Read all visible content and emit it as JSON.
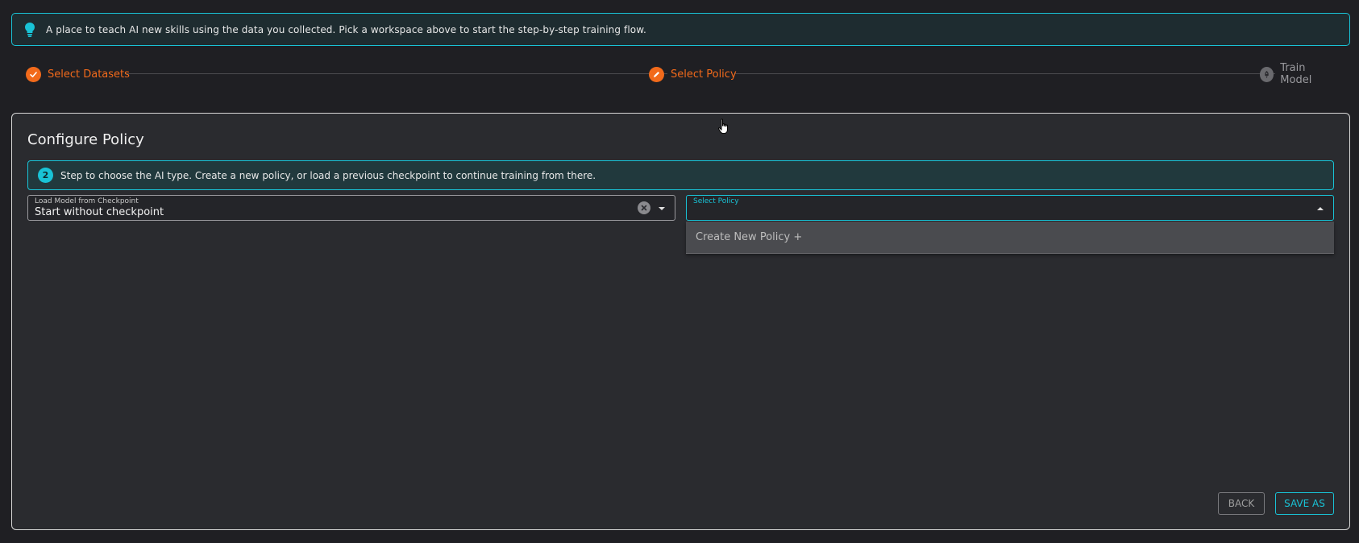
{
  "info_banner": {
    "icon": "lightbulb-icon",
    "text": "A place to teach AI new skills using the data you collected. Pick a workspace above to start the step-by-step training flow."
  },
  "stepper": {
    "steps": [
      {
        "label": "Select Datasets",
        "state": "done",
        "icon": "check-icon"
      },
      {
        "label": "Select Policy",
        "state": "active",
        "icon": "pencil-icon"
      },
      {
        "label": "Train Model",
        "state": "pending",
        "icon": "rocket-icon"
      }
    ]
  },
  "panel": {
    "title": "Configure Policy",
    "step_note": {
      "number": "2",
      "text": "Step to choose the AI type. Create a new policy, or load a previous checkpoint to continue training from there."
    },
    "checkpoint_select": {
      "label": "Load Model from Checkpoint",
      "value": "Start without checkpoint"
    },
    "policy_select": {
      "label": "Select Policy",
      "value": "",
      "options": [
        "Create New Policy +"
      ]
    },
    "buttons": {
      "back": "BACK",
      "save_as": "SAVE AS"
    }
  },
  "colors": {
    "accent_cyan": "#19c3d6",
    "accent_orange": "#f26a1b",
    "background": "#1f1f23",
    "panel": "#2a2b2f"
  }
}
